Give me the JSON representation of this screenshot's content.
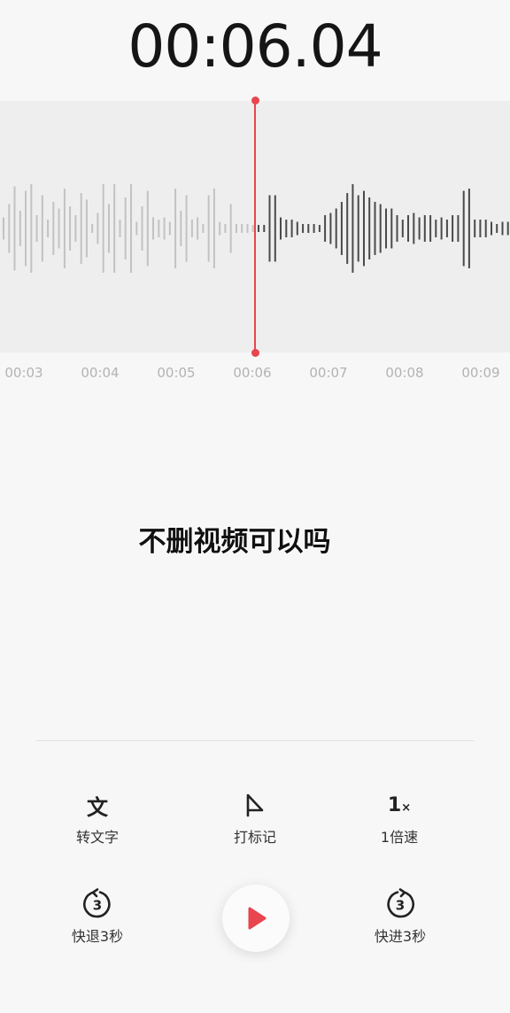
{
  "recorder": {
    "elapsed_time": "00:06.04",
    "timeline_ticks": [
      "00:03",
      "00:04",
      "00:05",
      "00:06",
      "00:07",
      "00:08",
      "00:09"
    ],
    "colors": {
      "accent": "#e8454e",
      "played_bar": "#c2c2c2",
      "unplayed_bar": "#4a4a4a",
      "wave_bg": "#eeeeee"
    },
    "waveform_heights": [
      0.25,
      0.55,
      0.95,
      0.4,
      0.85,
      1.0,
      0.3,
      0.75,
      0.2,
      0.6,
      0.45,
      0.9,
      0.5,
      0.3,
      0.8,
      0.65,
      0.1,
      0.35,
      1.0,
      0.55,
      1.0,
      0.2,
      0.7,
      1.0,
      0.15,
      0.5,
      0.85,
      0.25,
      0.2,
      0.25,
      0.15,
      0.9,
      0.4,
      0.75,
      0.2,
      0.25,
      0.1,
      0.75,
      0.9,
      0.15,
      0.1,
      0.55,
      0.1,
      0.1,
      0.1,
      0.08,
      0.08,
      0.08,
      0.75,
      0.75,
      0.25,
      0.2,
      0.2,
      0.15,
      0.1,
      0.1,
      0.1,
      0.08,
      0.3,
      0.35,
      0.45,
      0.6,
      0.8,
      1.0,
      0.75,
      0.85,
      0.7,
      0.6,
      0.55,
      0.45,
      0.45,
      0.3,
      0.2,
      0.3,
      0.35,
      0.25,
      0.3,
      0.3,
      0.2,
      0.25,
      0.2,
      0.3,
      0.3,
      0.85,
      0.9,
      0.2,
      0.2,
      0.2,
      0.15,
      0.1,
      0.15,
      0.15
    ],
    "playhead_fraction": 0.5
  },
  "caption": {
    "text": "不删视频可以吗"
  },
  "controls": {
    "transcribe": {
      "icon": "文",
      "label": "转文字"
    },
    "mark": {
      "label": "打标记"
    },
    "speed": {
      "value": "1",
      "unit": "×",
      "label": "1倍速"
    },
    "rewind": {
      "seconds": "3",
      "label": "快退3秒"
    },
    "forward": {
      "seconds": "3",
      "label": "快进3秒"
    },
    "play": {
      "icon": "play-icon"
    }
  }
}
